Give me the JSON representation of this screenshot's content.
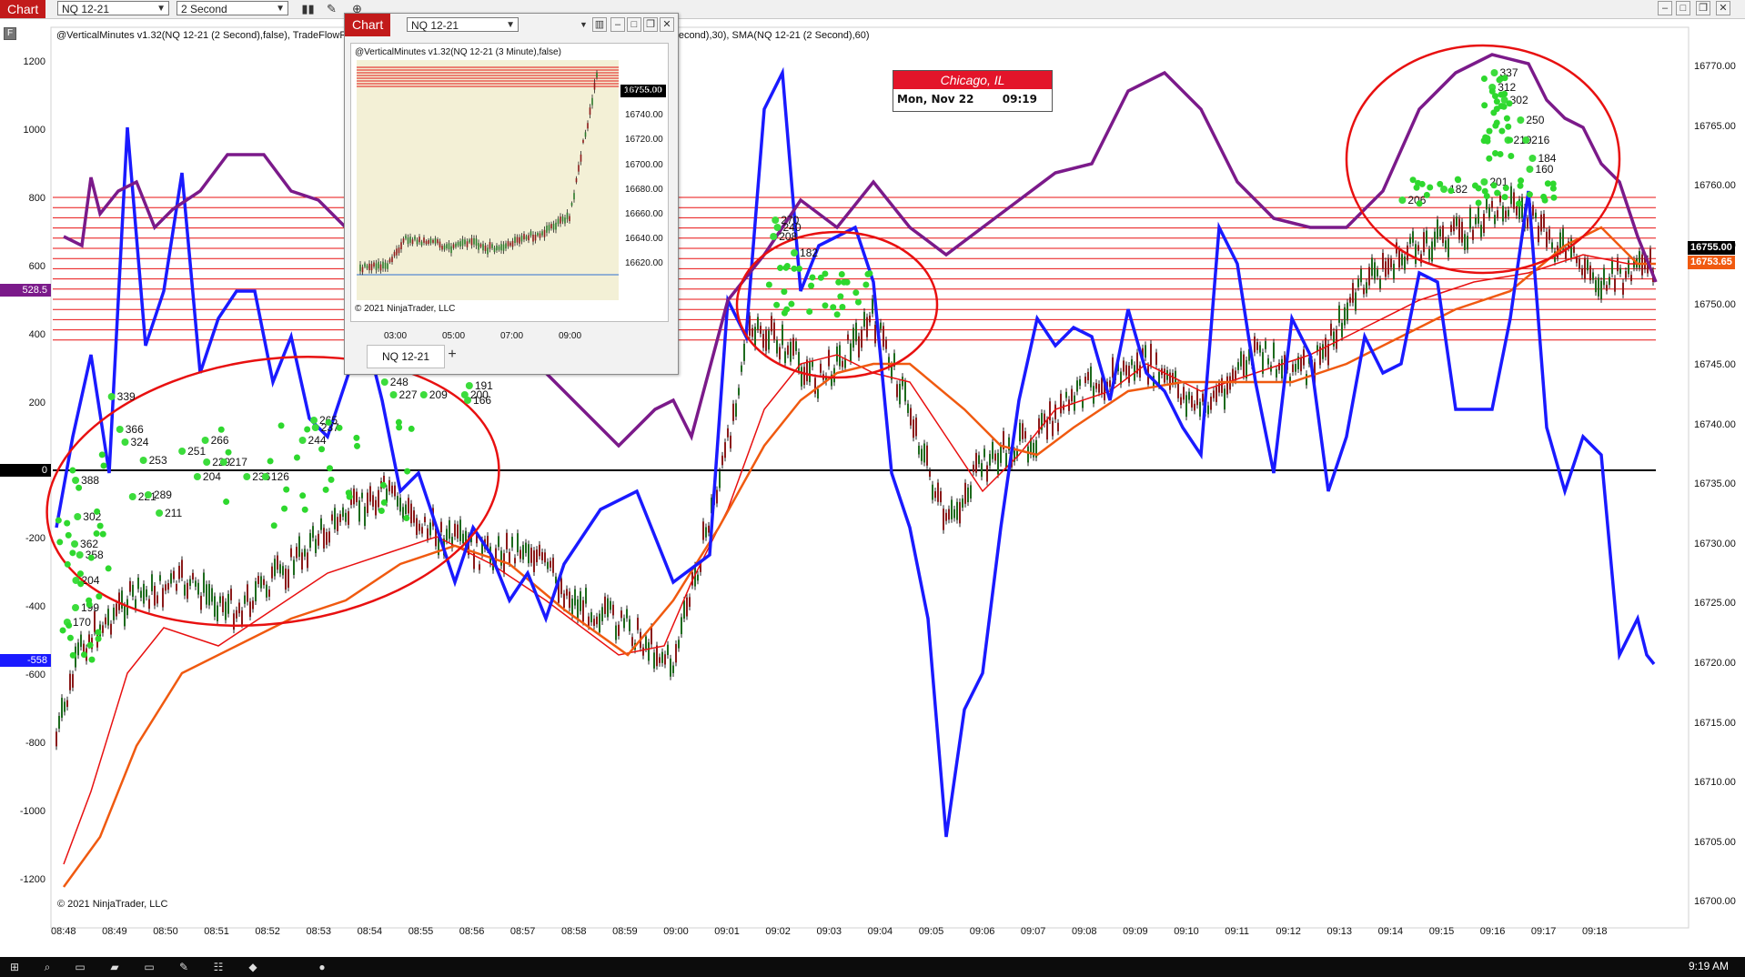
{
  "toolbar": {
    "chart_tab": "Chart",
    "instrument": "NQ 12-21",
    "interval": "2 Second",
    "icons": [
      "bar-chart-icon",
      "pencil-icon",
      "zoom-in-icon",
      "zoom-out-icon",
      "pointer-icon",
      "data-box-icon",
      "indicators-icon",
      "strategies-icon",
      "chart-trader-icon",
      "properties-icon",
      "templates-icon"
    ],
    "window_buttons": [
      "restore-icon",
      "maximize-icon",
      "close-icon"
    ]
  },
  "main": {
    "indicator_label": "@VerticalMinutes v1.32(NQ 12-21 (2 Second),false), TradeFlowRis…                                                   …-21 (2 Second),true,TradeFlowRiskNQFast.txt), SMA(NQ 12-21 (2 Second),30), SMA(NQ 12-21 (2 Second),60)",
    "copyright": "© 2021 NinjaTrader, LLC",
    "left_axis": [
      "1200",
      "1000",
      "800",
      "600",
      "400",
      "200",
      "0",
      "-200",
      "-400",
      "-600",
      "-800",
      "-1000",
      "-1200"
    ],
    "right_axis": [
      "16770.00",
      "16765.00",
      "16760.00",
      "16755.00",
      "16750.00",
      "16745.00",
      "16740.00",
      "16735.00",
      "16730.00",
      "16725.00",
      "16720.00",
      "16715.00",
      "16710.00",
      "16705.00",
      "16700.00"
    ],
    "time_axis": [
      "08:48",
      "08:49",
      "08:50",
      "08:51",
      "08:52",
      "08:53",
      "08:54",
      "08:55",
      "08:56",
      "08:57",
      "08:58",
      "08:59",
      "09:00",
      "09:01",
      "09:02",
      "09:03",
      "09:04",
      "09:05",
      "09:06",
      "09:07",
      "09:08",
      "09:09",
      "09:10",
      "09:11",
      "09:12",
      "09:13",
      "09:14",
      "09:15",
      "09:16",
      "09:17",
      "09:18"
    ],
    "flags": {
      "purple": "528.5",
      "zero": "0",
      "blue": "-558",
      "price_black": "16755.00",
      "price_orange": "16753.65"
    },
    "colors": {
      "purple": "#7b1a8a",
      "blue": "#1a1aff",
      "red": "#e81010",
      "orange": "#f05a10",
      "bull": "#1d6b1d",
      "bear": "#8b1a1a"
    },
    "order_labels": [
      {
        "t": "339"
      },
      {
        "t": "366"
      },
      {
        "t": "324"
      },
      {
        "t": "388"
      },
      {
        "t": "302"
      },
      {
        "t": "362"
      },
      {
        "t": "358"
      },
      {
        "t": "204"
      },
      {
        "t": "199"
      },
      {
        "t": "170"
      },
      {
        "t": "253"
      },
      {
        "t": "221"
      },
      {
        "t": "289"
      },
      {
        "t": "211"
      },
      {
        "t": "266"
      },
      {
        "t": "251"
      },
      {
        "t": "229"
      },
      {
        "t": "217"
      },
      {
        "t": "204"
      },
      {
        "t": "236"
      },
      {
        "t": "126"
      },
      {
        "t": "244"
      },
      {
        "t": "237"
      },
      {
        "t": "265"
      },
      {
        "t": "300"
      },
      {
        "t": "248"
      },
      {
        "t": "227"
      },
      {
        "t": "209"
      },
      {
        "t": "200"
      },
      {
        "t": "191"
      },
      {
        "t": "166"
      },
      {
        "t": "336"
      },
      {
        "t": "270"
      },
      {
        "t": "240"
      },
      {
        "t": "208"
      },
      {
        "t": "182"
      },
      {
        "t": "337"
      },
      {
        "t": "312"
      },
      {
        "t": "302"
      },
      {
        "t": "250"
      },
      {
        "t": "219"
      },
      {
        "t": "216"
      },
      {
        "t": "184"
      },
      {
        "t": "160"
      },
      {
        "t": "201"
      },
      {
        "t": "182"
      },
      {
        "t": "206"
      }
    ]
  },
  "clock": {
    "city": "Chicago, IL",
    "date": "Mon, Nov 22",
    "time": "09:19"
  },
  "subwindow": {
    "tab": "Chart",
    "instrument": "NQ 12-21",
    "indicator_label": "@VerticalMinutes v1.32(NQ 12-21 (3 Minute),false)",
    "copyright": "© 2021 NinjaTrader, LLC",
    "price_flag": "16755.00",
    "y_axis": [
      "16760.00",
      "16740.00",
      "16720.00",
      "16700.00",
      "16680.00",
      "16660.00",
      "16640.00",
      "16620.00"
    ],
    "x_axis": [
      "03:00",
      "05:00",
      "07:00",
      "09:00"
    ],
    "bottom_tab": "NQ 12-21",
    "add_tab": "+"
  },
  "taskbar": {
    "items": [
      "windows-start-icon",
      "search-icon",
      "task-view-icon",
      "file-explorer-icon",
      "cmd-icon",
      "notepad-icon",
      "network-icon",
      "paint-icon",
      "app-icon"
    ],
    "clock": "9:19 AM"
  }
}
